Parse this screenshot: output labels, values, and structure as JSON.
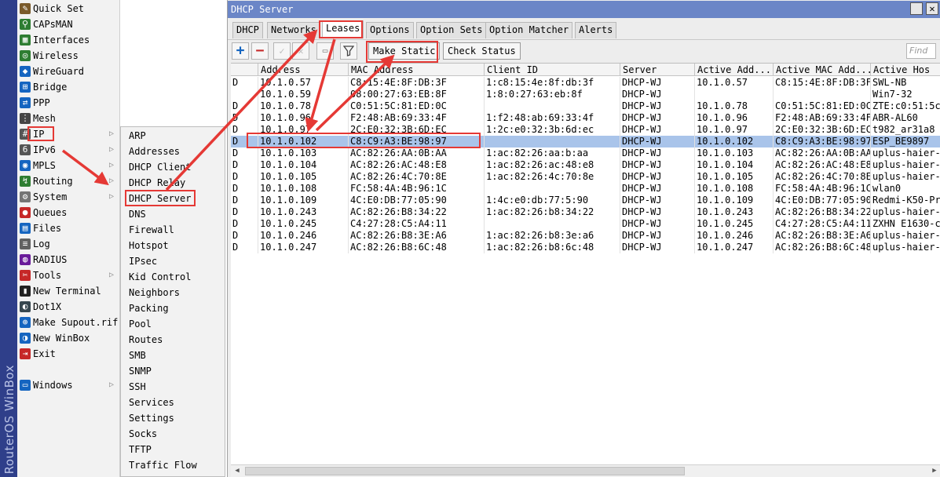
{
  "brand": "RouterOS WinBox",
  "menu": [
    {
      "label": "Quick Set",
      "icon": "quick-set-icon",
      "color": "#7a5a2a",
      "glyph": "✎",
      "arrow": false
    },
    {
      "label": "CAPsMAN",
      "icon": "capsman-icon",
      "color": "#2e7d32",
      "glyph": "⚲",
      "arrow": false
    },
    {
      "label": "Interfaces",
      "icon": "interfaces-icon",
      "color": "#2e7d32",
      "glyph": "▦",
      "arrow": false
    },
    {
      "label": "Wireless",
      "icon": "wireless-icon",
      "color": "#2e7d32",
      "glyph": "◎",
      "arrow": false
    },
    {
      "label": "WireGuard",
      "icon": "wireguard-icon",
      "color": "#1565c0",
      "glyph": "◆",
      "arrow": false
    },
    {
      "label": "Bridge",
      "icon": "bridge-icon",
      "color": "#1565c0",
      "glyph": "⊞",
      "arrow": false
    },
    {
      "label": "PPP",
      "icon": "ppp-icon",
      "color": "#1565c0",
      "glyph": "⇄",
      "arrow": false
    },
    {
      "label": "Mesh",
      "icon": "mesh-icon",
      "color": "#444444",
      "glyph": "⋮",
      "arrow": false
    },
    {
      "label": "IP",
      "icon": "ip-icon",
      "color": "#555555",
      "glyph": "#",
      "arrow": true
    },
    {
      "label": "IPv6",
      "icon": "ipv6-icon",
      "color": "#555555",
      "glyph": "6",
      "arrow": true
    },
    {
      "label": "MPLS",
      "icon": "mpls-icon",
      "color": "#1565c0",
      "glyph": "◉",
      "arrow": true
    },
    {
      "label": "Routing",
      "icon": "routing-icon",
      "color": "#2e7d32",
      "glyph": "↯",
      "arrow": true
    },
    {
      "label": "System",
      "icon": "system-icon",
      "color": "#757575",
      "glyph": "⚙",
      "arrow": true
    },
    {
      "label": "Queues",
      "icon": "queues-icon",
      "color": "#c62828",
      "glyph": "●",
      "arrow": false
    },
    {
      "label": "Files",
      "icon": "files-icon",
      "color": "#1565c0",
      "glyph": "▤",
      "arrow": false
    },
    {
      "label": "Log",
      "icon": "log-icon",
      "color": "#616161",
      "glyph": "≡",
      "arrow": false
    },
    {
      "label": "RADIUS",
      "icon": "radius-icon",
      "color": "#6a1b9a",
      "glyph": "◍",
      "arrow": false
    },
    {
      "label": "Tools",
      "icon": "tools-icon",
      "color": "#c62828",
      "glyph": "✂",
      "arrow": true
    },
    {
      "label": "New Terminal",
      "icon": "terminal-icon",
      "color": "#212121",
      "glyph": "▮",
      "arrow": false
    },
    {
      "label": "Dot1X",
      "icon": "dot1x-icon",
      "color": "#37474f",
      "glyph": "◐",
      "arrow": false
    },
    {
      "label": "Make Supout.rif",
      "icon": "supout-icon",
      "color": "#1565c0",
      "glyph": "⊕",
      "arrow": false
    },
    {
      "label": "New WinBox",
      "icon": "winbox-icon",
      "color": "#1565c0",
      "glyph": "◑",
      "arrow": false
    },
    {
      "label": "Exit",
      "icon": "exit-icon",
      "color": "#c62828",
      "glyph": "⇥",
      "arrow": false
    },
    {
      "label": "Windows",
      "icon": "windows-icon",
      "color": "#1565c0",
      "glyph": "▭",
      "arrow": true
    }
  ],
  "submenu": [
    "ARP",
    "Addresses",
    "DHCP Client",
    "DHCP Relay",
    "DHCP Server",
    "DNS",
    "Firewall",
    "Hotspot",
    "IPsec",
    "Kid Control",
    "Neighbors",
    "Packing",
    "Pool",
    "Routes",
    "SMB",
    "SNMP",
    "SSH",
    "Services",
    "Settings",
    "Socks",
    "TFTP",
    "Traffic Flow"
  ],
  "window": {
    "title": "DHCP Server",
    "tabs": [
      "DHCP",
      "Networks",
      "Leases",
      "Options",
      "Option Sets",
      "Option Matcher",
      "Alerts"
    ],
    "active_tab": "Leases",
    "toolbar": {
      "make_static": "Make Static",
      "check_status": "Check Status",
      "find_placeholder": "Find"
    },
    "columns": [
      "",
      "Address",
      "MAC Address",
      "Client ID",
      "Server",
      "Active Add...",
      "Active MAC Add...",
      "Active Hos"
    ],
    "rows": [
      [
        "D",
        "10.1.0.57",
        "C8:15:4E:8F:DB:3F",
        "1:c8:15:4e:8f:db:3f",
        "DHCP-WJ",
        "10.1.0.57",
        "C8:15:4E:8F:DB:3F",
        "SWL-NB"
      ],
      [
        "",
        "10.1.0.59",
        "08:00:27:63:EB:8F",
        "1:8:0:27:63:eb:8f",
        "DHCP-WJ",
        "",
        "",
        "Win7-32"
      ],
      [
        "D",
        "10.1.0.78",
        "C0:51:5C:81:ED:0C",
        "",
        "DHCP-WJ",
        "10.1.0.78",
        "C0:51:5C:81:ED:0C",
        "ZTE:c0:51:5c"
      ],
      [
        "D",
        "10.1.0.96",
        "F2:48:AB:69:33:4F",
        "1:f2:48:ab:69:33:4f",
        "DHCP-WJ",
        "10.1.0.96",
        "F2:48:AB:69:33:4F",
        "ABR-AL60"
      ],
      [
        "D",
        "10.1.0.97",
        "2C:E0:32:3B:6D:EC",
        "1:2c:e0:32:3b:6d:ec",
        "DHCP-WJ",
        "10.1.0.97",
        "2C:E0:32:3B:6D:EC",
        "t982_ar31a8"
      ],
      [
        "D",
        "10.1.0.102",
        "C8:C9:A3:BE:98:97",
        "",
        "DHCP-WJ",
        "10.1.0.102",
        "C8:C9:A3:BE:98:97",
        "ESP_BE9897"
      ],
      [
        "D",
        "10.1.0.103",
        "AC:82:26:AA:0B:AA",
        "1:ac:82:26:aa:b:aa",
        "DHCP-WJ",
        "10.1.0.103",
        "AC:82:26:AA:0B:AA",
        "uplus-haier-"
      ],
      [
        "D",
        "10.1.0.104",
        "AC:82:26:AC:48:E8",
        "1:ac:82:26:ac:48:e8",
        "DHCP-WJ",
        "10.1.0.104",
        "AC:82:26:AC:48:E8",
        "uplus-haier-"
      ],
      [
        "D",
        "10.1.0.105",
        "AC:82:26:4C:70:8E",
        "1:ac:82:26:4c:70:8e",
        "DHCP-WJ",
        "10.1.0.105",
        "AC:82:26:4C:70:8E",
        "uplus-haier-"
      ],
      [
        "D",
        "10.1.0.108",
        "FC:58:4A:4B:96:1C",
        "",
        "DHCP-WJ",
        "10.1.0.108",
        "FC:58:4A:4B:96:1C",
        "wlan0"
      ],
      [
        "D",
        "10.1.0.109",
        "4C:E0:DB:77:05:90",
        "1:4c:e0:db:77:5:90",
        "DHCP-WJ",
        "10.1.0.109",
        "4C:E0:DB:77:05:90",
        "Redmi-K50-Pr"
      ],
      [
        "D",
        "10.1.0.243",
        "AC:82:26:B8:34:22",
        "1:ac:82:26:b8:34:22",
        "DHCP-WJ",
        "10.1.0.243",
        "AC:82:26:B8:34:22",
        "uplus-haier-"
      ],
      [
        "D",
        "10.1.0.245",
        "C4:27:28:C5:A4:11",
        "",
        "DHCP-WJ",
        "10.1.0.245",
        "C4:27:28:C5:A4:11",
        "ZXHN E1630-c"
      ],
      [
        "D",
        "10.1.0.246",
        "AC:82:26:B8:3E:A6",
        "1:ac:82:26:b8:3e:a6",
        "DHCP-WJ",
        "10.1.0.246",
        "AC:82:26:B8:3E:A6",
        "uplus-haier-"
      ],
      [
        "D",
        "10.1.0.247",
        "AC:82:26:B8:6C:48",
        "1:ac:82:26:b8:6c:48",
        "DHCP-WJ",
        "10.1.0.247",
        "AC:82:26:B8:6C:48",
        "uplus-haier-"
      ]
    ],
    "selected_row": 5
  },
  "colors": {
    "title_bar": "#6b86c7",
    "selection": "#a9c4ea",
    "annotation": "#e53935",
    "brand": "#2f3f8a"
  }
}
